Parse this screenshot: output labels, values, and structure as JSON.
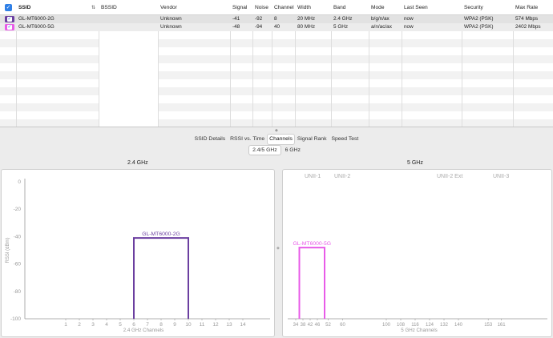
{
  "table": {
    "headers": {
      "ssid": "SSID",
      "bssid": "BSSID",
      "vendor": "Vendor",
      "signal": "Signal",
      "noise": "Noise",
      "channel": "Channel",
      "width": "Width",
      "band": "Band",
      "mode": "Mode",
      "last_seen": "Last Seen",
      "security": "Security",
      "max_rate": "Max Rate"
    },
    "rows": [
      {
        "ssid": "GL-MT6000-2G",
        "bssid": "",
        "vendor": "Unknown",
        "signal": "-41",
        "noise": "-92",
        "channel": "8",
        "width": "20 MHz",
        "band": "2.4 GHz",
        "mode": "b/g/n/ax",
        "last_seen": "now",
        "security": "WPA2 (PSK)",
        "max_rate": "574 Mbps",
        "color": "#6b3fa0"
      },
      {
        "ssid": "GL-MT6000-5G",
        "bssid": "",
        "vendor": "Unknown",
        "signal": "-48",
        "noise": "-94",
        "channel": "40",
        "width": "80 MHz",
        "band": "5 GHz",
        "mode": "a/n/ac/ax",
        "last_seen": "now",
        "security": "WPA2 (PSK)",
        "max_rate": "2402 Mbps",
        "color": "#e85ce8"
      }
    ]
  },
  "tabs": [
    {
      "label": "SSID Details",
      "active": false
    },
    {
      "label": "RSSI vs. Time",
      "active": false
    },
    {
      "label": "Channels",
      "active": true
    },
    {
      "label": "Signal Rank",
      "active": false
    },
    {
      "label": "Speed Test",
      "active": false
    }
  ],
  "band_buttons": [
    {
      "label": "2.4/5 GHz",
      "active": true
    },
    {
      "label": "6 GHz",
      "active": false
    }
  ],
  "panels": {
    "left_title": "2.4 GHz",
    "right_title": "5 GHz"
  },
  "chart_data": [
    {
      "type": "area",
      "title": "2.4 GHz",
      "xlabel": "2.4 GHz Channels",
      "ylabel": "RSSI (dBm)",
      "ylim": [
        -100,
        0
      ],
      "yticks": [
        0,
        -20,
        -40,
        -60,
        -80,
        -100
      ],
      "xticks": [
        1,
        2,
        3,
        4,
        5,
        6,
        7,
        8,
        9,
        10,
        11,
        12,
        13,
        14
      ],
      "xlim": [
        -2,
        16
      ],
      "grid": false,
      "series": [
        {
          "name": "GL-MT6000-2G",
          "color": "#6b3fa0",
          "x": [
            6,
            6,
            10,
            10
          ],
          "y": [
            -100,
            -41,
            -41,
            -100
          ]
        }
      ]
    },
    {
      "type": "area",
      "title": "5 GHz",
      "xlabel": "5 GHz Channels",
      "ylim": [
        -100,
        0
      ],
      "xticks": [
        34,
        38,
        42,
        46,
        52,
        60,
        100,
        108,
        116,
        124,
        132,
        140,
        153,
        161
      ],
      "band_labels": [
        "UNII-1",
        "UNII-2",
        "UNII-2 Ext",
        "UNII-3"
      ],
      "grid": false,
      "series": [
        {
          "name": "GL-MT6000-5G",
          "color": "#e85ce8",
          "x": [
            36,
            36,
            50,
            50
          ],
          "y": [
            -100,
            -48,
            -48,
            -100
          ]
        }
      ]
    }
  ]
}
